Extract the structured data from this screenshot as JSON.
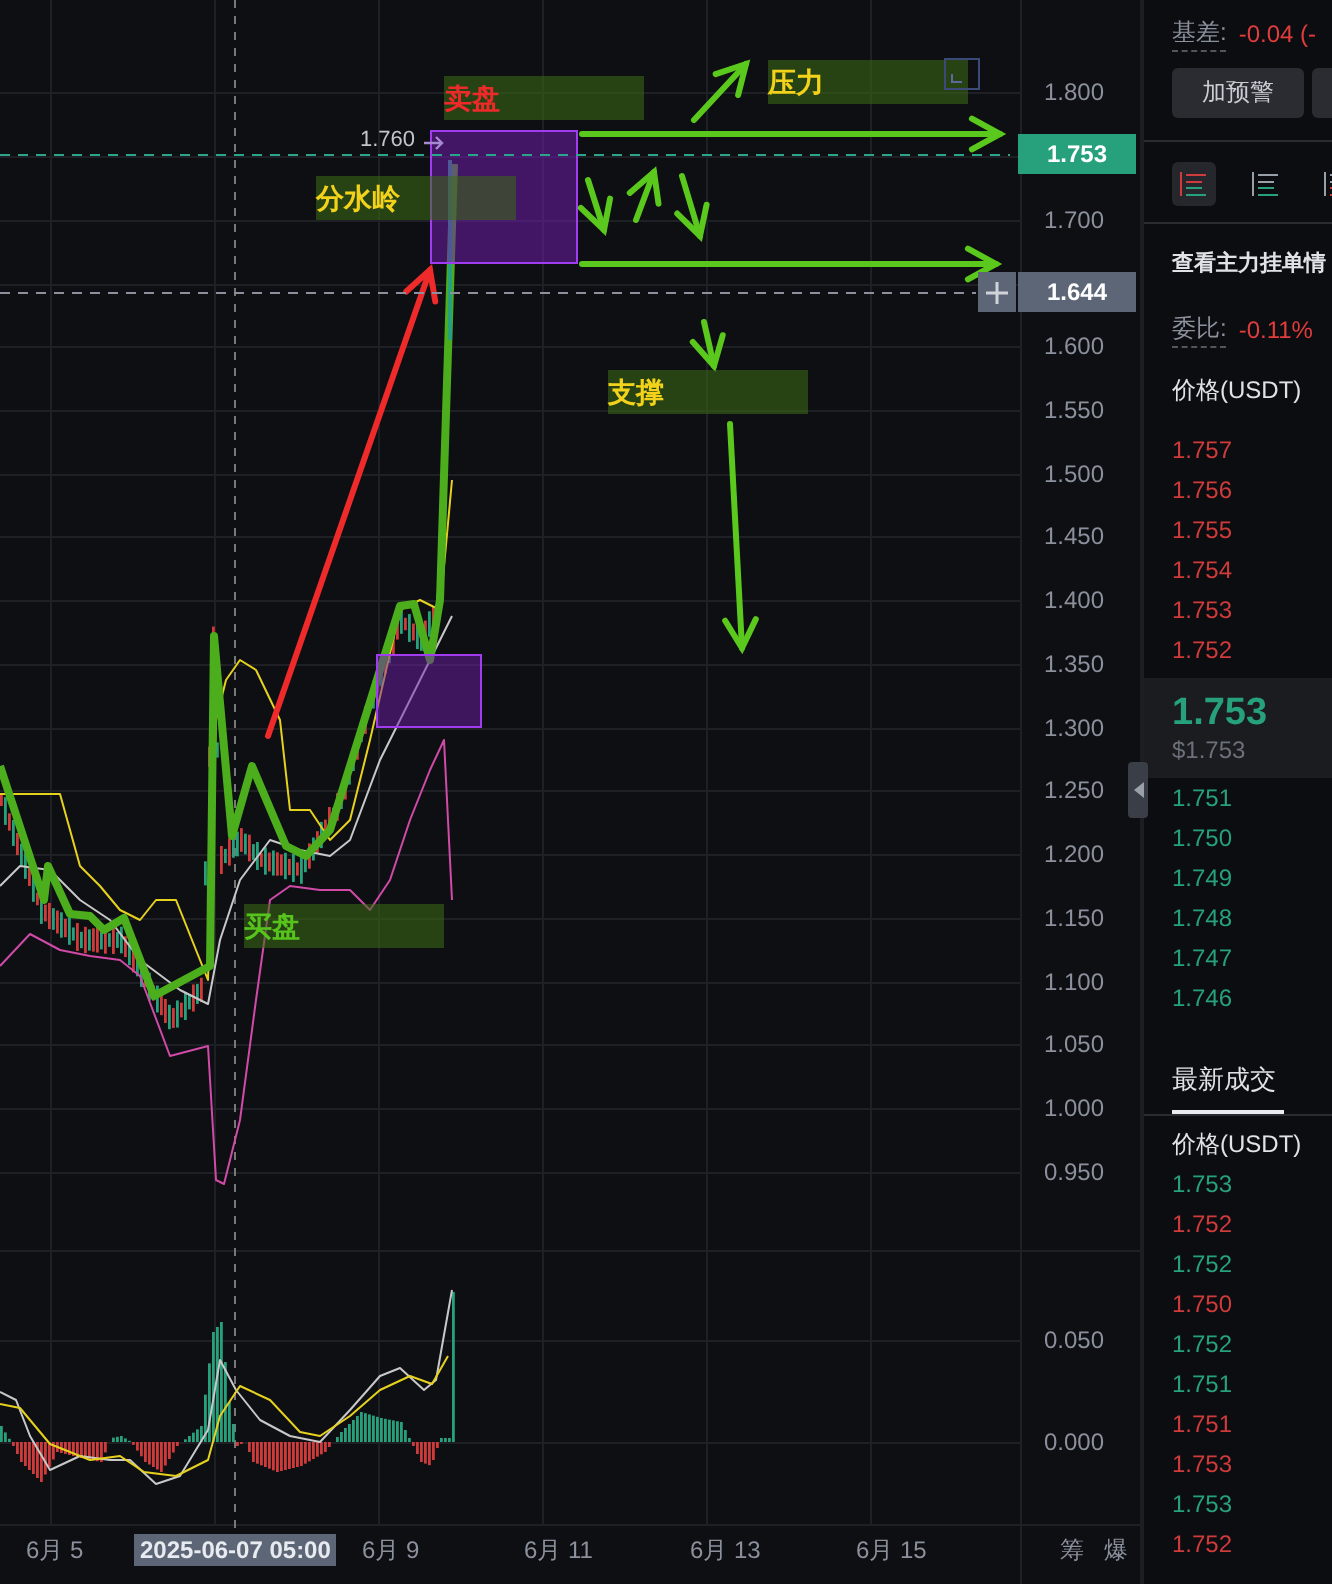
{
  "chart": {
    "price_axis": [
      "1.800",
      "1.700",
      "1.600",
      "1.550",
      "1.500",
      "1.450",
      "1.400",
      "1.350",
      "1.300",
      "1.250",
      "1.200",
      "1.150",
      "1.100",
      "1.050",
      "1.000",
      "0.950"
    ],
    "price_tags": [
      {
        "label": "1.753",
        "kind": "last"
      },
      {
        "label": "1.644",
        "kind": "crosshair"
      }
    ],
    "high_label": "1.760",
    "annotations": [
      {
        "text": "卖盘",
        "color": "#ec2a2a"
      },
      {
        "text": "压力",
        "color": "#f2d21a"
      },
      {
        "text": "分水岭",
        "color": "#f2d21a"
      },
      {
        "text": "支撑",
        "color": "#f2d21a"
      },
      {
        "text": "买盘",
        "color": "#56c41c"
      }
    ],
    "indicator_axis": [
      "0.050",
      "0.000"
    ],
    "time_axis": [
      {
        "label": "6月 5",
        "selected": false
      },
      {
        "label": "2025-06-07 05:00",
        "selected": true
      },
      {
        "label": "6月 9",
        "selected": false
      },
      {
        "label": "6月 11",
        "selected": false
      },
      {
        "label": "6月 13",
        "selected": false
      },
      {
        "label": "6月 15",
        "selected": false
      }
    ],
    "side_tabs": [
      "筹",
      "爆"
    ]
  },
  "panel": {
    "basis_label": "基差:",
    "basis_value": "-0.04 (-",
    "alert_button": "加预警",
    "view_tabs": [
      {
        "selected": true
      },
      {
        "selected": false
      },
      {
        "selected": false
      }
    ],
    "main_orders_link": "查看主力挂单情",
    "ratio_label": "委比:",
    "ratio_value": "-0.11%",
    "book_header": "价格(USDT)",
    "asks": [
      "1.757",
      "1.756",
      "1.755",
      "1.754",
      "1.753",
      "1.752"
    ],
    "last_price": "1.753",
    "last_price_usd": "$1.753",
    "bids": [
      "1.751",
      "1.750",
      "1.749",
      "1.748",
      "1.747",
      "1.746"
    ],
    "trades_tab": "最新成交",
    "trades_header": "价格(USDT)",
    "trades": [
      {
        "price": "1.753",
        "color": "#26a17b"
      },
      {
        "price": "1.752",
        "color": "#cf3b3b"
      },
      {
        "price": "1.752",
        "color": "#26a17b"
      },
      {
        "price": "1.750",
        "color": "#cf3b3b"
      },
      {
        "price": "1.752",
        "color": "#26a17b"
      },
      {
        "price": "1.751",
        "color": "#26a17b"
      },
      {
        "price": "1.751",
        "color": "#cf3b3b"
      },
      {
        "price": "1.753",
        "color": "#cf3b3b"
      },
      {
        "price": "1.753",
        "color": "#26a17b"
      },
      {
        "price": "1.752",
        "color": "#cf3b3b"
      }
    ]
  }
}
